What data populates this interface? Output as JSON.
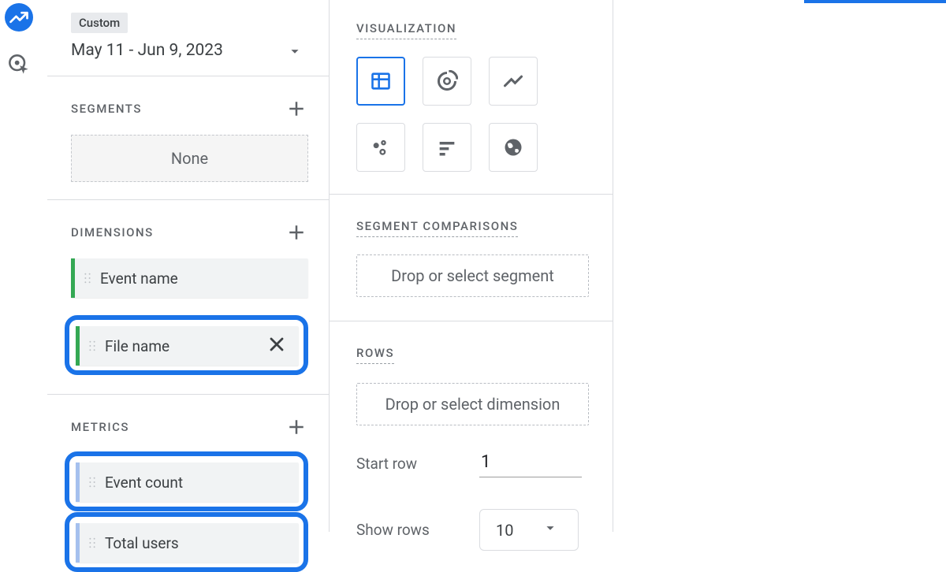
{
  "date": {
    "preset": "Custom",
    "range": "May 11 - Jun 9, 2023"
  },
  "segments": {
    "title": "SEGMENTS",
    "placeholder": "None"
  },
  "dimensions": {
    "title": "DIMENSIONS",
    "items": [
      "Event name",
      "File name"
    ]
  },
  "metrics": {
    "title": "METRICS",
    "items": [
      "Event count",
      "Total users"
    ]
  },
  "visualization": {
    "title": "VISUALIZATION"
  },
  "segment_comparisons": {
    "title": "SEGMENT COMPARISONS",
    "placeholder": "Drop or select segment"
  },
  "rows": {
    "title": "ROWS",
    "placeholder": "Drop or select dimension",
    "start_row_label": "Start row",
    "start_row_value": "1",
    "show_rows_label": "Show rows",
    "show_rows_value": "10"
  }
}
